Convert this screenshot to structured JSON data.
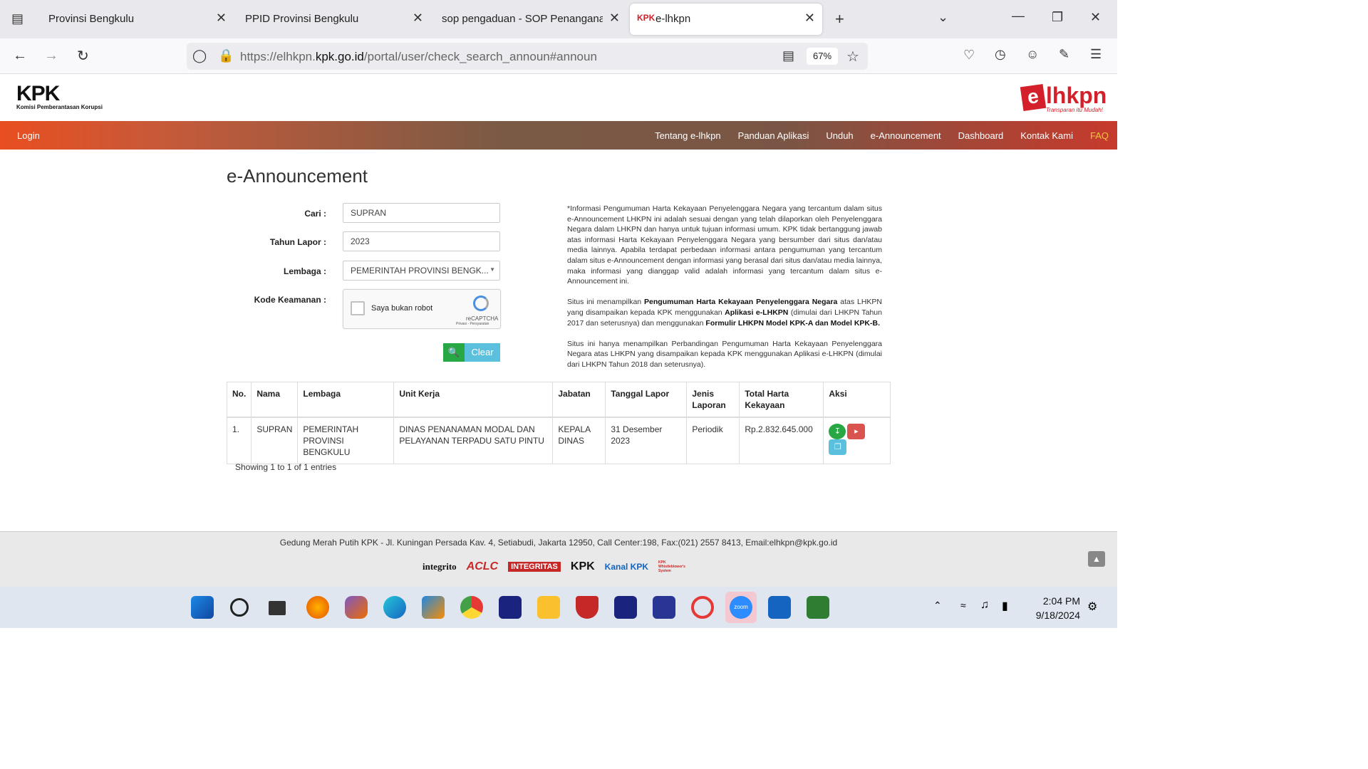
{
  "browser": {
    "tabs": [
      {
        "label": "Provinsi Bengkulu",
        "active": false
      },
      {
        "label": "PPID Provinsi Bengkulu",
        "active": false
      },
      {
        "label": "sop pengaduan - SOP Penanganan",
        "active": false
      },
      {
        "label": "e-lhkpn",
        "active": true
      }
    ],
    "url_prefix": "https://elhkpn.",
    "url_domain": "kpk.go.id",
    "url_path": "/portal/user/check_search_announ#announ",
    "zoom": "67%"
  },
  "header": {
    "logo_text": "KPK",
    "logo_subtext": "Komisi Pemberantasan Korupsi",
    "brand_e": "e",
    "brand_rest": "lhkpn",
    "brand_tagline": "Transparan itu Mudah!"
  },
  "menu": {
    "login": "Login",
    "items": [
      "Tentang e-lhkpn",
      "Panduan Aplikasi",
      "Unduh",
      "e-Announcement",
      "Dashboard",
      "Kontak Kami",
      "FAQ"
    ]
  },
  "page": {
    "title": "e-Announcement"
  },
  "form": {
    "cari_label": "Cari :",
    "cari_value": "SUPRAN",
    "tahun_label": "Tahun Lapor :",
    "tahun_value": "2023",
    "lembaga_label": "Lembaga :",
    "lembaga_value": "PEMERINTAH PROVINSI BENGK...",
    "kode_label": "Kode Keamanan :",
    "captcha_label": "Saya bukan robot",
    "captcha_brand": "reCAPTCHA",
    "captcha_links": "Privasi - Persyaratan",
    "clear_label": "Clear"
  },
  "info": {
    "p1": "*Informasi Pengumuman Harta Kekayaan Penyelenggara Negara yang tercantum dalam situs e-Announcement LHKPN ini adalah sesuai dengan yang telah dilaporkan oleh Penyelenggara Negara dalam LHKPN dan hanya untuk tujuan informasi umum. KPK tidak bertanggung jawab atas informasi Harta Kekayaan Penyelenggara Negara yang bersumber dari situs dan/atau media lainnya. Apabila terdapat perbedaan informasi antara pengumuman yang tercantum dalam situs e-Announcement dengan informasi yang berasal dari situs dan/atau media lainnya, maka informasi yang dianggap valid adalah informasi yang tercantum dalam situs e-Announcement ini.",
    "p2a": "Situs ini menampilkan ",
    "p2b": "Pengumuman Harta Kekayaan Penyelenggara Negara",
    "p2c": " atas LHKPN yang disampaikan kepada KPK menggunakan ",
    "p2d": "Aplikasi e-LHKPN",
    "p2e": " (dimulai dari LHKPN Tahun 2017 dan seterusnya) dan menggunakan ",
    "p2f": "Formulir LHKPN Model KPK-A dan Model KPK-B.",
    "p3": "Situs ini hanya menampilkan Perbandingan Pengumuman Harta Kekayaan Penyelenggara Negara atas LHKPN yang disampaikan kepada KPK menggunakan Aplikasi e-LHKPN (dimulai dari LHKPN Tahun 2018 dan seterusnya)."
  },
  "table": {
    "headers": [
      "No.",
      "Nama",
      "Lembaga",
      "Unit Kerja",
      "Jabatan",
      "Tanggal Lapor",
      "Jenis Laporan",
      "Total Harta Kekayaan",
      "Aksi"
    ],
    "rows": [
      {
        "no": "1.",
        "nama": "SUPRAN",
        "lembaga": "PEMERINTAH PROVINSI BENGKULU",
        "unit": "DINAS PENANAMAN MODAL DAN PELAYANAN TERPADU SATU PINTU",
        "jabatan": "KEPALA DINAS",
        "tanggal": "31 Desember 2023",
        "jenis": "Periodik",
        "total": "Rp.2.832.645.000"
      }
    ],
    "showing": "Showing 1 to 1 of 1 entries"
  },
  "footer": {
    "address": "Gedung Merah Putih KPK - Jl. Kuningan Persada Kav. 4, Setiabudi, Jakarta 12950, Call Center:198, Fax:(021) 2557 8413, Email:elhkpn@kpk.go.id",
    "partners": [
      "integrito",
      "ACLC",
      "INTEGRITAS",
      "KPK",
      "Kanal KPK",
      "KPK Whistleblower's System"
    ]
  },
  "taskbar": {
    "time": "2:04 PM",
    "date": "9/18/2024"
  },
  "colors": {
    "accent_orange": "#e84e20",
    "brand_red": "#d4202a",
    "search_green": "#27a844",
    "clear_blue": "#5bc0de"
  }
}
